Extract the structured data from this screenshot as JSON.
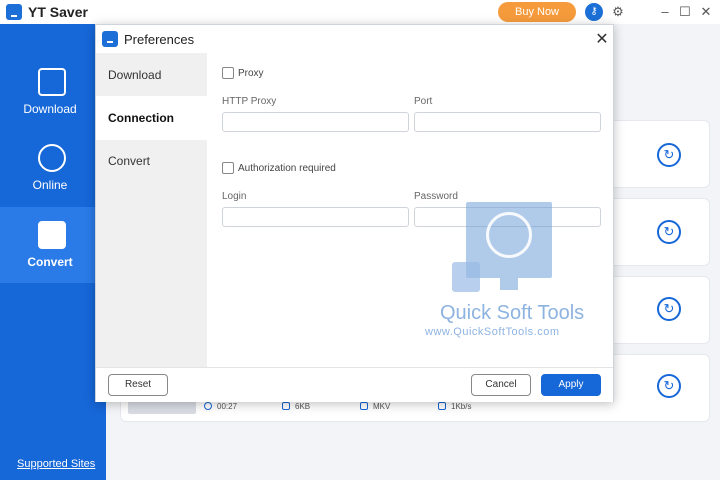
{
  "app": {
    "title": "YT Saver",
    "buy_label": "Buy Now"
  },
  "sidebar": {
    "items": [
      {
        "label": "Download",
        "icon": "download-icon"
      },
      {
        "label": "Online",
        "icon": "globe-icon"
      },
      {
        "label": "Convert",
        "icon": "convert-icon",
        "active": true
      }
    ],
    "supported_sites": "Supported Sites"
  },
  "background_row": {
    "duration": "00:27",
    "size": "6KB",
    "format": "MKV",
    "speed": "1Kb/s"
  },
  "dialog": {
    "title": "Preferences",
    "tabs": [
      "Download",
      "Connection",
      "Convert"
    ],
    "active_tab": "Connection",
    "proxy_label": "Proxy",
    "http_proxy_label": "HTTP Proxy",
    "port_label": "Port",
    "auth_label": "Authorization required",
    "login_label": "Login",
    "password_label": "Password",
    "http_proxy_value": "",
    "port_value": "",
    "login_value": "",
    "password_value": "",
    "reset_label": "Reset",
    "cancel_label": "Cancel",
    "apply_label": "Apply"
  },
  "watermark": {
    "brand": "Quick Soft Tools",
    "url": "www.QuickSoftTools.com"
  },
  "colors": {
    "accent": "#1667d8",
    "buy": "#f59b3c"
  }
}
